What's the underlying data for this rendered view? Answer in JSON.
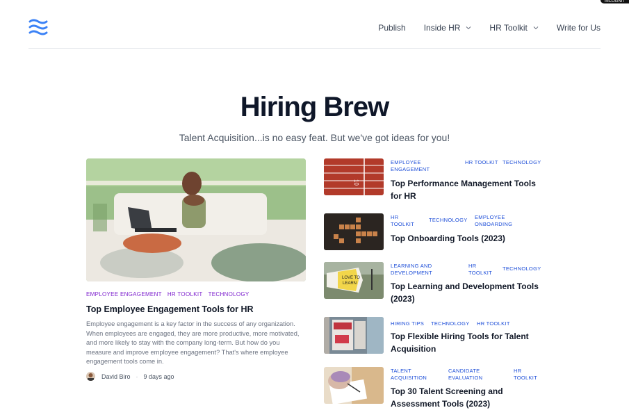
{
  "badge": "INCOGNIT",
  "nav": {
    "items": [
      {
        "label": "Publish",
        "dropdown": false
      },
      {
        "label": "Inside HR",
        "dropdown": true
      },
      {
        "label": "HR Toolkit",
        "dropdown": true
      },
      {
        "label": "Write for Us",
        "dropdown": false
      }
    ]
  },
  "hero": {
    "title": "Hiring Brew",
    "subtitle": "Talent Acquisition...is no easy feat. But we've got ideas for you!"
  },
  "featured": {
    "tags": [
      "EMPLOYEE ENGAGEMENT",
      "HR TOOLKIT",
      "TECHNOLOGY"
    ],
    "title": "Top Employee Engagement Tools for HR",
    "excerpt": "Employee engagement is a key factor in the success of any organization. When employees are engaged, they are more productive, more motivated, and more likely to stay with the company long-term. But how do you measure and improve employee engagement? That's where employee engagement tools come in.",
    "author": "David Biro",
    "date": "9 days ago"
  },
  "articles": [
    {
      "tags": [
        "EMPLOYEE ENGAGEMENT",
        "HR TOOLKIT",
        "TECHNOLOGY"
      ],
      "title": "Top Performance Management Tools for HR"
    },
    {
      "tags": [
        "HR TOOLKIT",
        "TECHNOLOGY",
        "EMPLOYEE ONBOARDING"
      ],
      "title": "Top Onboarding Tools (2023)"
    },
    {
      "tags": [
        "LEARNING AND DEVELOPMENT",
        "HR TOOLKIT",
        "TECHNOLOGY"
      ],
      "title": "Top Learning and Development Tools (2023)"
    },
    {
      "tags": [
        "HIRING TIPS",
        "TECHNOLOGY",
        "HR TOOLKIT"
      ],
      "title": "Top Flexible Hiring Tools for Talent Acquisition"
    },
    {
      "tags": [
        "TALENT ACQUISITION",
        "CANDIDATE EVALUATION",
        "HR TOOLKIT"
      ],
      "title": "Top 30 Talent Screening and Assessment Tools (2023)"
    }
  ],
  "images": {
    "featured": "woman-on-couch-with-laptop",
    "thumbs": [
      "running-track",
      "scrabble-tiles",
      "love-to-learn-sign",
      "we-are-hiring-sign",
      "hand-writing-on-paper"
    ]
  },
  "colors": {
    "logo": "#3b82f6",
    "featured_tag": "#7e22ce",
    "list_tag": "#1d4ed8",
    "title": "#0f1729"
  }
}
